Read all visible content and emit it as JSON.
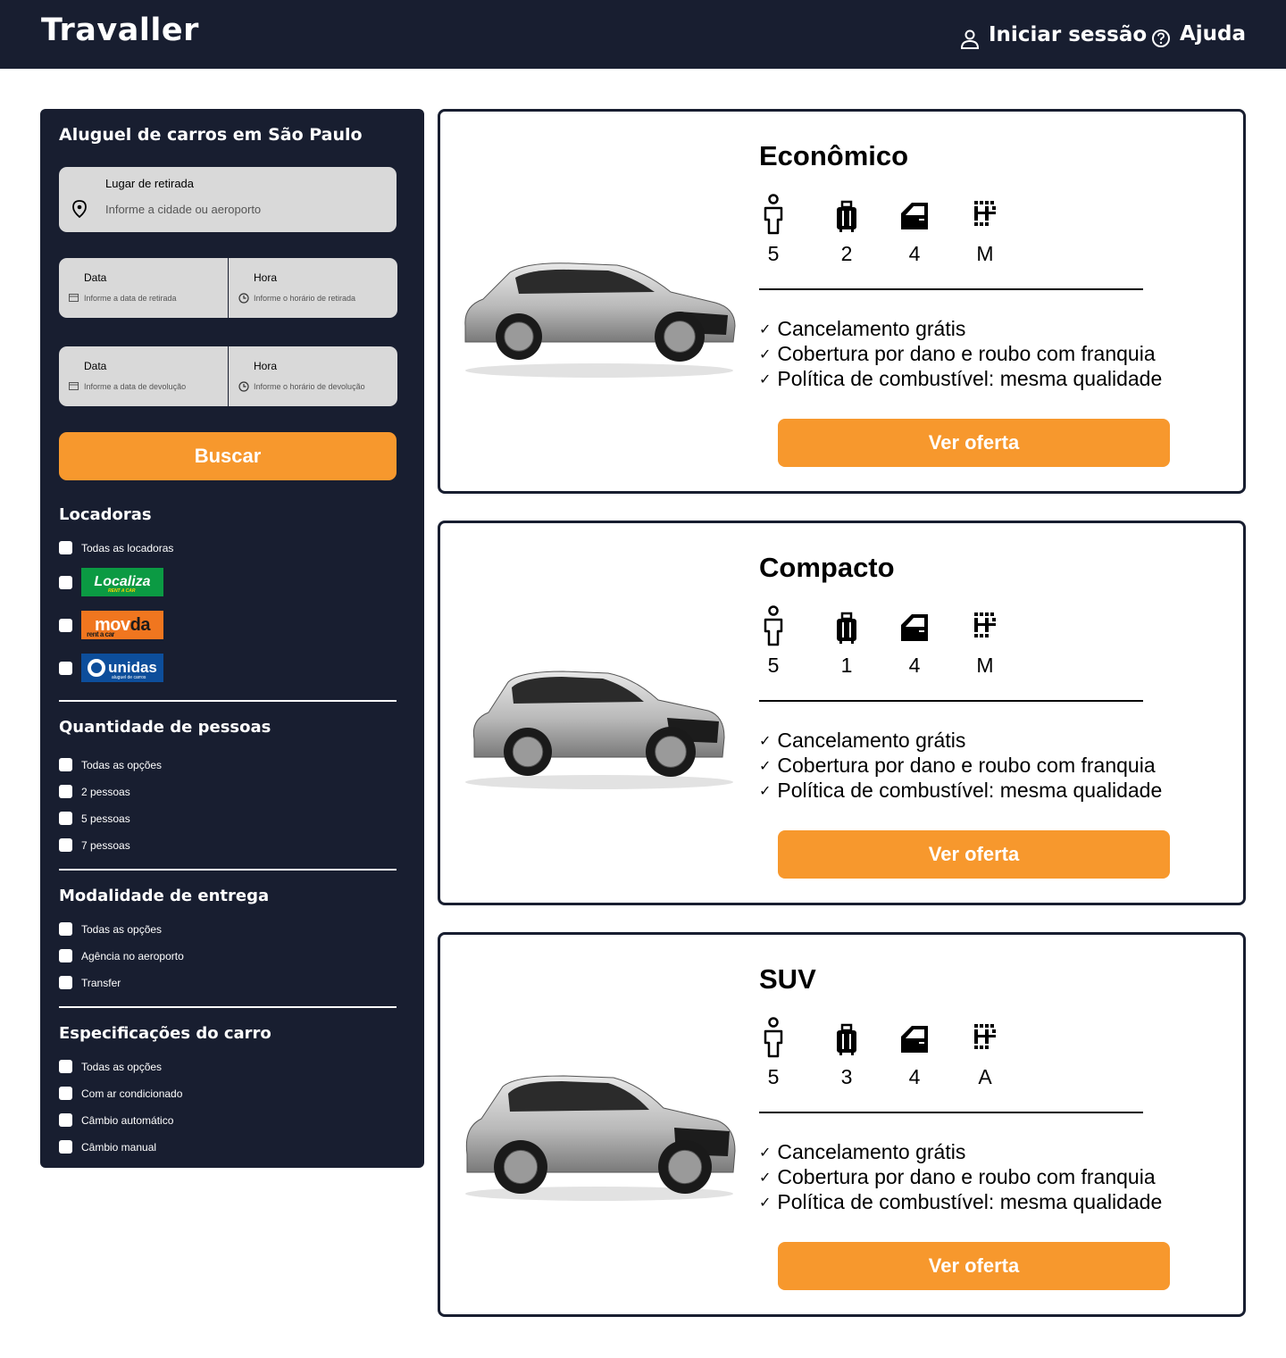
{
  "header": {
    "brand": "Travaller",
    "login": "Iniciar sessão",
    "help": "Ajuda"
  },
  "sidebar": {
    "title": "Aluguel de carros em São Paulo",
    "pickup": {
      "label": "Lugar de retirada",
      "placeholder": "Informe a cidade ou aeroporto"
    },
    "pickup_date": {
      "label": "Data",
      "placeholder": "Informe a data de retirada"
    },
    "pickup_time": {
      "label": "Hora",
      "placeholder": "Informe o horário de retirada"
    },
    "return_date": {
      "label": "Data",
      "placeholder": "Informe a data de devolução"
    },
    "return_time": {
      "label": "Hora",
      "placeholder": "Informe o horário de devolução"
    },
    "search_label": "Buscar",
    "rental_companies": {
      "title": "Locadoras",
      "all": "Todas as locadoras",
      "logos": [
        {
          "name": "Localiza",
          "sub": "RENT A CAR"
        },
        {
          "name": "mov",
          "name2": "da",
          "sub": "rent a car"
        },
        {
          "name": "unidas",
          "sub": "aluguel de carros"
        }
      ]
    },
    "people": {
      "title": "Quantidade de pessoas",
      "options": [
        "Todas as opções",
        "2 pessoas",
        "5 pessoas",
        "7 pessoas"
      ]
    },
    "delivery": {
      "title": "Modalidade de entrega",
      "options": [
        "Todas as opções",
        "Agência no aeroporto",
        "Transfer"
      ]
    },
    "specs": {
      "title": "Especificações do carro",
      "options": [
        "Todas as opções",
        "Com ar condicionado",
        "Câmbio automático",
        "Câmbio manual"
      ]
    }
  },
  "cards": [
    {
      "title": "Econômico",
      "people": "5",
      "bags": "2",
      "doors": "4",
      "transmission": "M",
      "kind": "hatch"
    },
    {
      "title": "Compacto",
      "people": "5",
      "bags": "1",
      "doors": "4",
      "transmission": "M",
      "kind": "compact"
    },
    {
      "title": "SUV",
      "people": "5",
      "bags": "3",
      "doors": "4",
      "transmission": "A",
      "kind": "suv"
    }
  ],
  "features": [
    "Cancelamento grátis",
    "Cobertura por dano e roubo com franquia",
    "Política de combustível: mesma qualidade"
  ],
  "offer_label": "Ver oferta",
  "colors": {
    "navy": "#181e30",
    "accent": "#f7982d",
    "field": "#d9d9d9"
  }
}
